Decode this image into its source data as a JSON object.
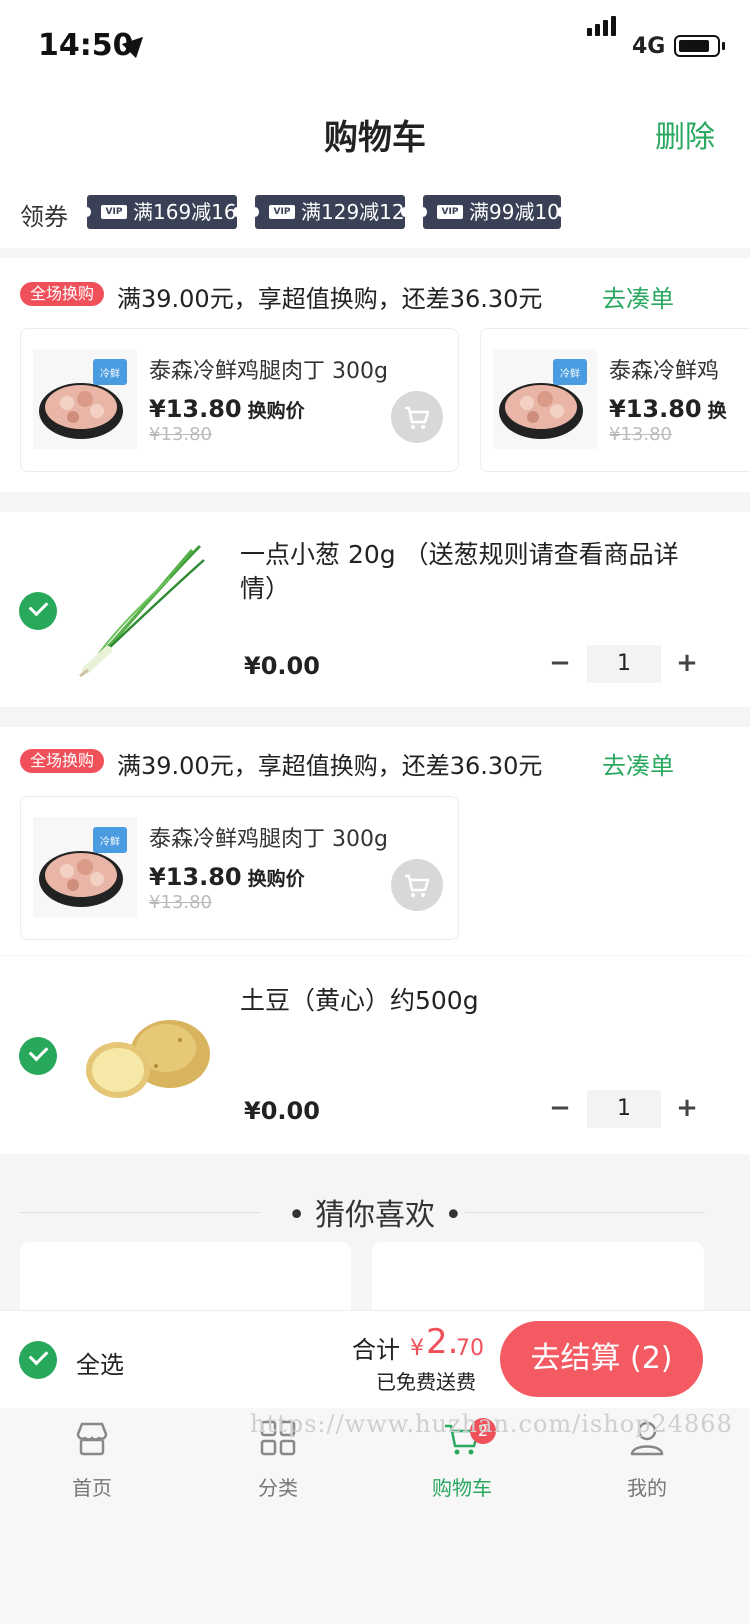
{
  "status_bar": {
    "time": "14:50",
    "network": "4G"
  },
  "header": {
    "title": "购物车",
    "delete_label": "删除"
  },
  "coupons": {
    "label": "领券",
    "vip_text": "VIP",
    "items": [
      "满169减16",
      "满129减12",
      "满99减10"
    ]
  },
  "promo_1": {
    "tag": "全场换购",
    "text": "满39.00元，享超值换购，还差36.30元",
    "link": "去凑单",
    "products": [
      {
        "name": "泰森冷鲜鸡腿肉丁 300g",
        "price": "¥13.80",
        "price_note": "换购价",
        "original_price": "¥13.80"
      },
      {
        "name": "泰森冷鲜鸡",
        "price": "¥13.80",
        "price_note": "换",
        "original_price": "¥13.80"
      }
    ]
  },
  "item_1": {
    "name": "一点小葱 20g （送葱规则请查看商品详情）",
    "price": "¥0.00",
    "quantity": "1"
  },
  "promo_2": {
    "tag": "全场换购",
    "text": "满39.00元，享超值换购，还差36.30元",
    "link": "去凑单",
    "products": [
      {
        "name": "泰森冷鲜鸡腿肉丁 300g",
        "price": "¥13.80",
        "price_note": "换购价",
        "original_price": "¥13.80"
      }
    ]
  },
  "item_2": {
    "name": "土豆（黄心）约500g",
    "price": "¥0.00",
    "quantity": "1"
  },
  "qty_controls": {
    "minus": "−",
    "plus": "+"
  },
  "recommend": {
    "title": "• 猜你喜欢 •"
  },
  "checkout": {
    "select_all": "全选",
    "total_label": "合计",
    "currency": "¥",
    "total_int": "2.",
    "total_dec": "70",
    "shipping": "已免费送费",
    "button": "去结算 (2)"
  },
  "tabbar": {
    "items": [
      {
        "label": "首页",
        "icon": "home-icon"
      },
      {
        "label": "分类",
        "icon": "category-icon"
      },
      {
        "label": "购物车",
        "icon": "cart-icon"
      },
      {
        "label": "我的",
        "icon": "profile-icon"
      }
    ],
    "cart_badge": "2"
  },
  "watermark": "https://www.huzhan.com/ishop24868",
  "colors": {
    "accent_green": "#2aa860",
    "promo_red": "#f0505a",
    "coupon_navy": "#3a4156",
    "checkout_red": "#f45a62"
  }
}
